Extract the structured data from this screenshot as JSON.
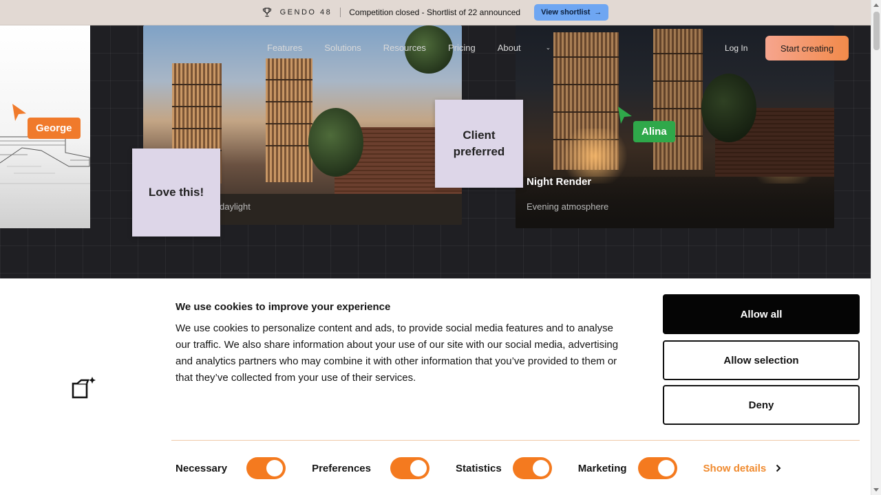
{
  "announcement": {
    "brand": "GENDO 48",
    "message": "Competition closed - Shortlist of 22 announced",
    "cta": "View shortlist"
  },
  "nav": {
    "items": [
      "Features",
      "Solutions",
      "Resources",
      "Pricing",
      "About"
    ],
    "login": "Log In",
    "start": "Start creating"
  },
  "hero": {
    "day_sub": "daylight",
    "night_title": "Night Render",
    "night_sub": "Evening atmosphere",
    "notes": {
      "love": "Love this!",
      "client": "Client preferred"
    },
    "cursors": {
      "george": "George",
      "alina": "Alina"
    }
  },
  "cookie": {
    "title": "We use cookies to improve your experience",
    "body": "We use cookies to personalize content and ads, to provide social media features and to analyse our traffic. We also share information about your use of our site with our social media, advertising and analytics partners who may combine it with other information that you’ve provided to them or that they’ve collected from your use of their services.",
    "allow_all": "Allow all",
    "allow_selection": "Allow selection",
    "deny": "Deny",
    "toggles": [
      "Necessary",
      "Preferences",
      "Statistics",
      "Marketing"
    ],
    "show_details": "Show details"
  },
  "colors": {
    "accent": "#f47a1f",
    "george": "#f07a2b",
    "alina": "#2fa84a",
    "note": "#ddd6e8",
    "cta_blue": "#6ea6f2"
  }
}
